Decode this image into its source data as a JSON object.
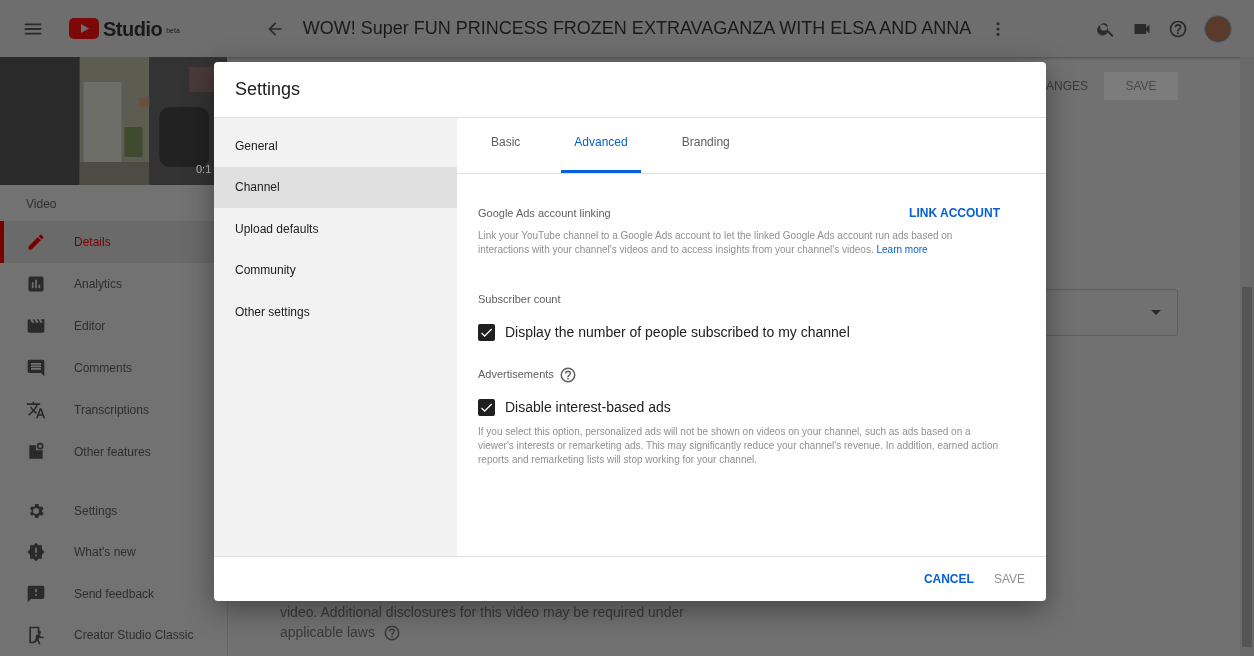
{
  "topbar": {
    "logo_text": "Studio",
    "logo_badge": "beta",
    "video_title": "WOW! Super FUN PRINCESS FROZEN EXTRAVAGANZA WITH ELSA AND ANNA"
  },
  "thumbnail": {
    "kind": "picture",
    "duration": "0:1"
  },
  "sidebar": {
    "section": "Video",
    "items": [
      {
        "label": "Details",
        "selected": true
      },
      {
        "label": "Analytics",
        "selected": false
      },
      {
        "label": "Editor",
        "selected": false
      },
      {
        "label": "Comments",
        "selected": false
      },
      {
        "label": "Transcriptions",
        "selected": false
      },
      {
        "label": "Other features",
        "selected": false
      }
    ],
    "bottom_items": [
      {
        "label": "Settings"
      },
      {
        "label": "What's new"
      },
      {
        "label": "Send feedback"
      },
      {
        "label": "Creator Studio Classic"
      }
    ]
  },
  "page": {
    "discard_button": "ANGES",
    "save_button": "SAVE",
    "disclosure_text": "video. Additional disclosures for this video may be required under",
    "laws_text": "applicable laws"
  },
  "dialog": {
    "title": "Settings",
    "nav": [
      {
        "label": "General",
        "selected": false
      },
      {
        "label": "Channel",
        "selected": true
      },
      {
        "label": "Upload defaults",
        "selected": false
      },
      {
        "label": "Community",
        "selected": false
      },
      {
        "label": "Other settings",
        "selected": false
      }
    ],
    "tabs": [
      {
        "label": "Basic",
        "selected": false
      },
      {
        "label": "Advanced",
        "selected": true
      },
      {
        "label": "Branding",
        "selected": false
      }
    ],
    "ads_linking": {
      "heading": "Google Ads account linking",
      "action": "LINK ACCOUNT",
      "description": "Link your YouTube channel to a Google Ads account to let the linked Google Ads account run ads based on interactions with your channel's videos and to access insights from your channel's videos.",
      "link": "Learn more"
    },
    "subscriber": {
      "heading": "Subscriber count",
      "checkbox": {
        "label": "Display the number of people subscribed to my channel",
        "checked": true
      }
    },
    "ads": {
      "heading": "Advertisements",
      "checkbox": {
        "label": "Disable interest-based ads",
        "checked": true
      },
      "description": "If you select this option, personalized ads will not be shown on videos on your channel, such as ads based on a viewer's interests or remarketing ads. This may significantly reduce your channel's revenue. In addition, earned action reports and remarketing lists will stop working for your channel."
    },
    "footer": {
      "cancel": "CANCEL",
      "save": "SAVE"
    }
  }
}
